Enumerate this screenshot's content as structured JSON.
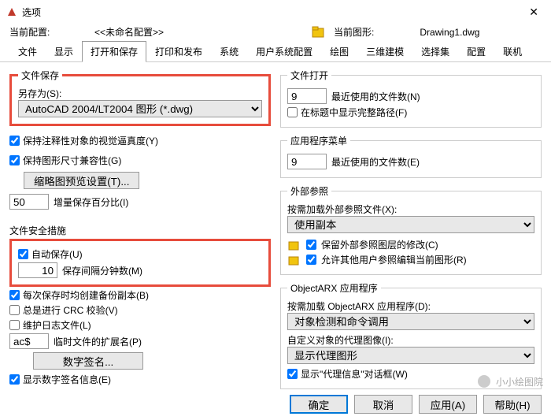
{
  "title": "选项",
  "profile": {
    "label": "当前配置:",
    "name": "<<未命名配置>>",
    "drawing_label": "当前图形:",
    "drawing_value": "Drawing1.dwg"
  },
  "tabs": [
    "文件",
    "显示",
    "打开和保存",
    "打印和发布",
    "系统",
    "用户系统配置",
    "绘图",
    "三维建模",
    "选择集",
    "配置",
    "联机"
  ],
  "left": {
    "file_save": {
      "legend": "文件保存",
      "save_as_label": "另存为(S):",
      "save_as_value": "AutoCAD 2004/LT2004 图形 (*.dwg)",
      "keep_anno": "保持注释性对象的视觉逼真度(Y)",
      "keep_size": "保持图形尺寸兼容性(G)",
      "thumb_btn": "缩略图预览设置(T)...",
      "incr_value": "50",
      "incr_label": "增量保存百分比(I)"
    },
    "safety": {
      "legend": "文件安全措施",
      "auto_save": "自动保存(U)",
      "interval_value": "10",
      "interval_label": "保存间隔分钟数(M)",
      "backup": "每次保存时均创建备份副本(B)",
      "crc": "总是进行 CRC 校验(V)",
      "log": "维护日志文件(L)",
      "ext_value": "ac$",
      "ext_label": "临时文件的扩展名(P)",
      "sig_btn": "数字签名...",
      "sig_check": "显示数字签名信息(E)"
    }
  },
  "right": {
    "file_open": {
      "legend": "文件打开",
      "recent_value": "9",
      "recent_label": "最近使用的文件数(N)",
      "show_path": "在标题中显示完整路径(F)"
    },
    "menu": {
      "legend": "应用程序菜单",
      "recent_value": "9",
      "recent_label": "最近使用的文件数(E)"
    },
    "xref": {
      "legend": "外部参照",
      "load_label": "按需加载外部参照文件(X):",
      "load_value": "使用副本",
      "keep_layers": "保留外部参照图层的修改(C)",
      "allow_edit": "允许其他用户参照编辑当前图形(R)"
    },
    "arx": {
      "legend": "ObjectARX 应用程序",
      "load_label": "按需加载 ObjectARX 应用程序(D):",
      "load_value": "对象检测和命令调用",
      "proxy_label": "自定义对象的代理图像(I):",
      "proxy_value": "显示代理图形",
      "show_dialog": "显示\"代理信息\"对话框(W)"
    }
  },
  "buttons": {
    "ok": "确定",
    "cancel": "取消",
    "apply": "应用(A)",
    "help": "帮助(H)"
  },
  "watermark": "小小绘图院"
}
